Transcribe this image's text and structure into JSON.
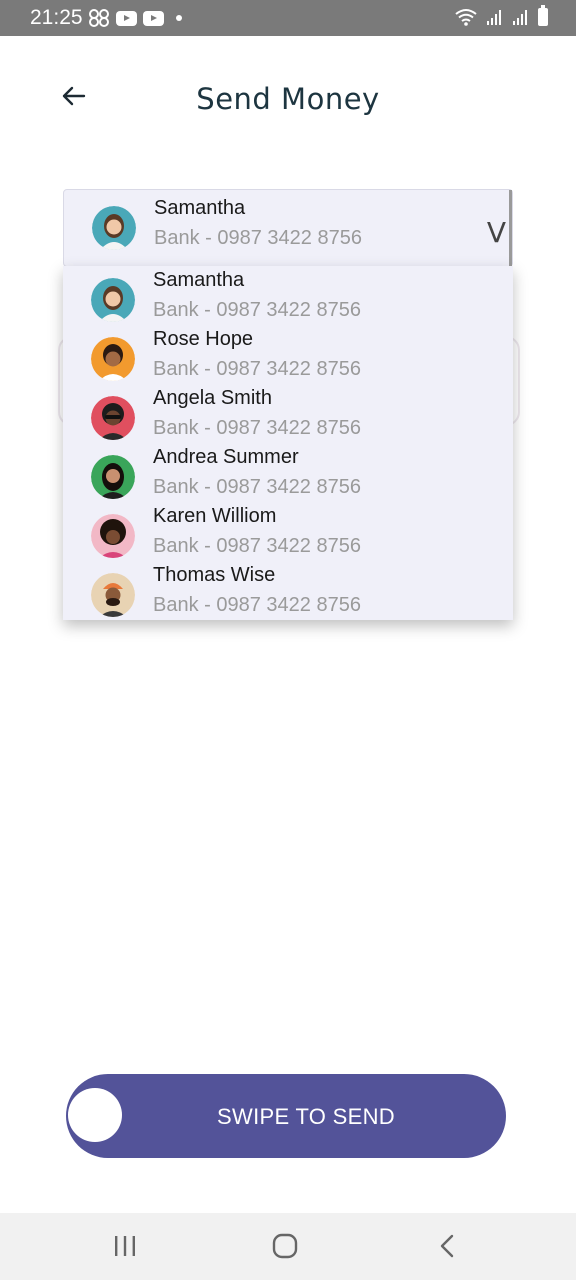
{
  "status_bar": {
    "time": "21:25",
    "left_icons": [
      "loop-icon",
      "youtube-icon",
      "youtube-icon",
      "dot-icon"
    ],
    "right_icons": [
      "wifi-icon",
      "signal-icon",
      "signal-icon",
      "battery-icon"
    ]
  },
  "header": {
    "title": "Send Money",
    "back_icon": "arrow-left-icon"
  },
  "recipient_select": {
    "selected": {
      "name": "Samantha",
      "account": "Bank - 0987 3422 8756",
      "avatar_color": "#4aa8b8"
    },
    "chevron": "V",
    "options": [
      {
        "name": "Samantha",
        "account": "Bank - 0987 3422 8756",
        "avatar_color": "#4aa8b8"
      },
      {
        "name": "Rose Hope",
        "account": "Bank - 0987 3422 8756",
        "avatar_color": "#f29a2e"
      },
      {
        "name": "Angela Smith",
        "account": "Bank - 0987 3422 8756",
        "avatar_color": "#e04f5f"
      },
      {
        "name": "Andrea Summer",
        "account": "Bank - 0987 3422 8756",
        "avatar_color": "#3aa55a"
      },
      {
        "name": "Karen Williom",
        "account": "Bank - 0987 3422 8756",
        "avatar_color": "#f2b8c6"
      },
      {
        "name": "Thomas Wise",
        "account": "Bank - 0987 3422 8756",
        "avatar_color": "#e8d3b3"
      }
    ]
  },
  "swipe_button": {
    "label": "SWIPE TO SEND",
    "color": "#535399"
  },
  "nav_bar": {
    "icons": [
      "recent-apps-icon",
      "home-icon",
      "back-icon"
    ]
  }
}
